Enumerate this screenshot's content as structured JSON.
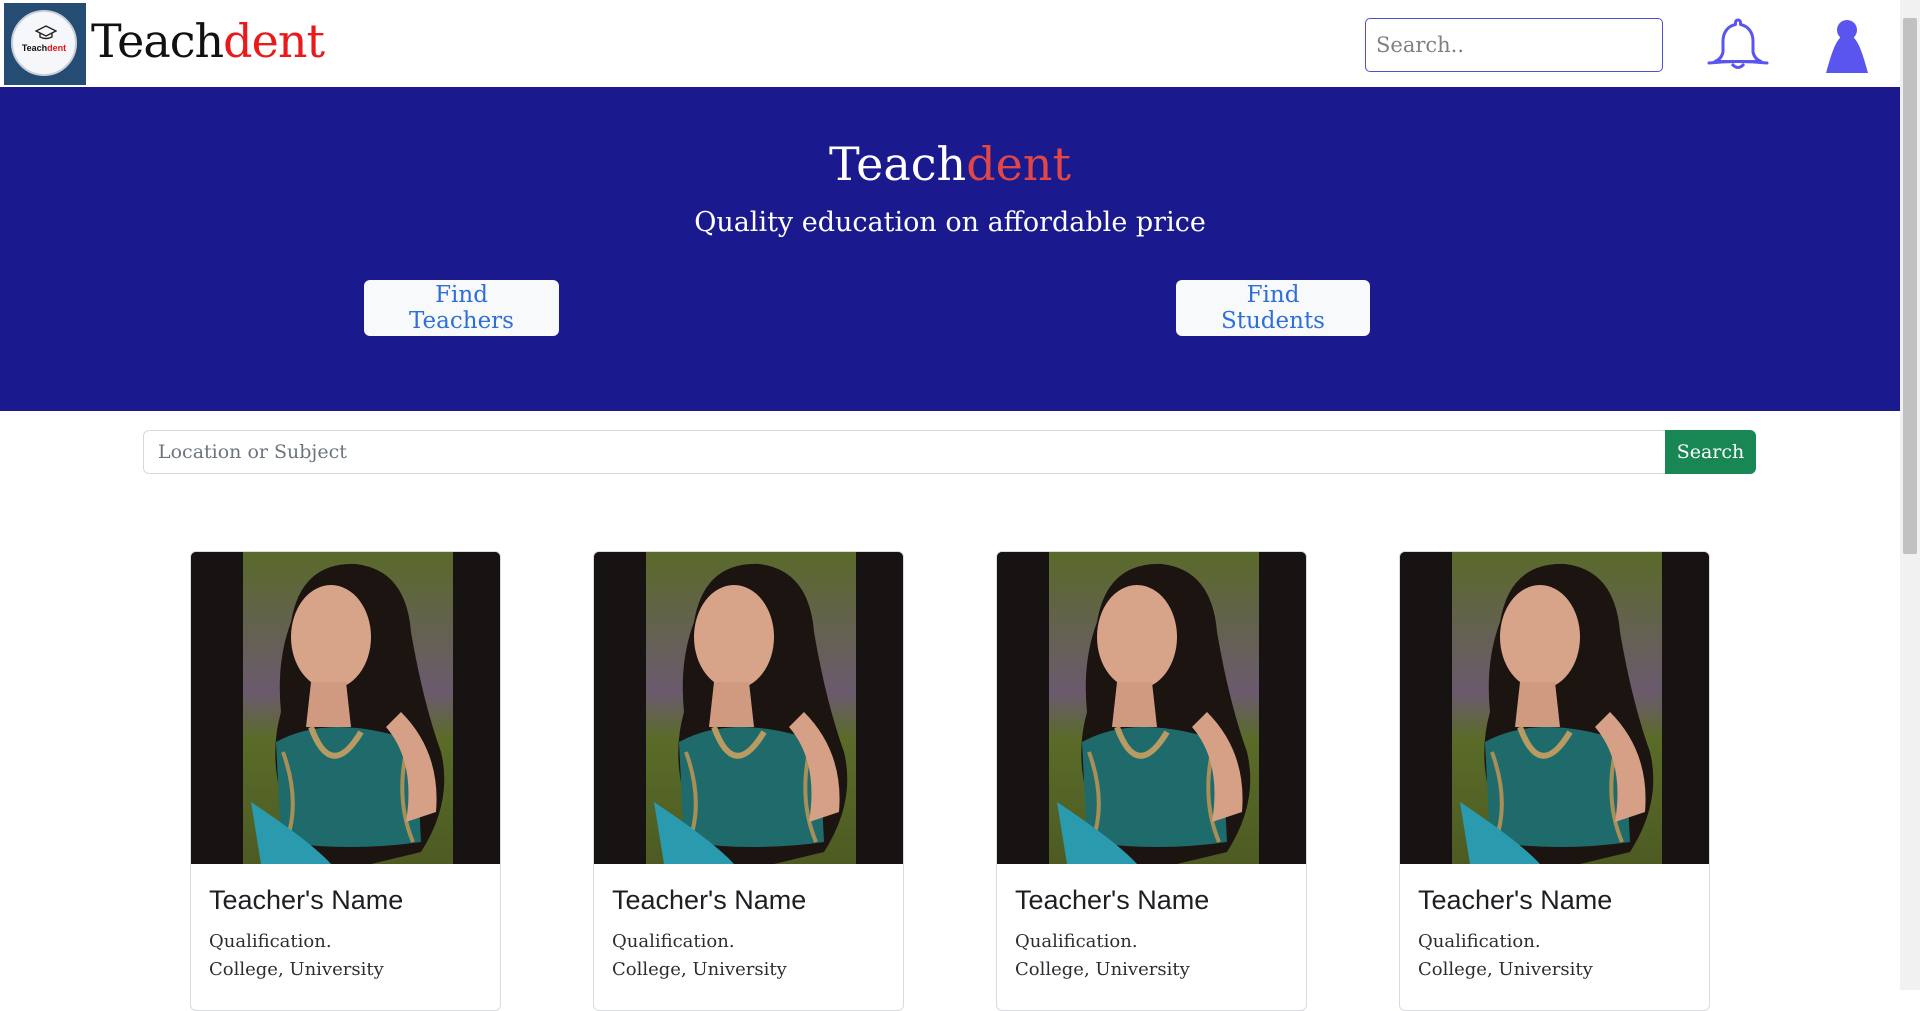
{
  "navbar": {
    "logo_text_black": "Teach",
    "logo_text_red": "dent",
    "brand_black": "Teach",
    "brand_red": "dent",
    "search_placeholder": "Search..",
    "icons": [
      "bell-icon",
      "user-icon"
    ],
    "accent_color": "#4a4fd6"
  },
  "hero": {
    "title_black": "Teach",
    "title_red": "dent",
    "subtitle": "Quality education on affordable price",
    "find_teachers_label": "Find Teachers",
    "find_students_label": "Find Students",
    "background_color": "#1b198e"
  },
  "search": {
    "placeholder": "Location or Subject",
    "button_label": "Search",
    "button_color": "#198754"
  },
  "cards": [
    {
      "name": "Teacher's Name",
      "qualification": "Qualification.",
      "college": "College, University"
    },
    {
      "name": "Teacher's Name",
      "qualification": "Qualification.",
      "college": "College, University"
    },
    {
      "name": "Teacher's Name",
      "qualification": "Qualification.",
      "college": "College, University"
    },
    {
      "name": "Teacher's Name",
      "qualification": "Qualification.",
      "college": "College, University"
    }
  ]
}
